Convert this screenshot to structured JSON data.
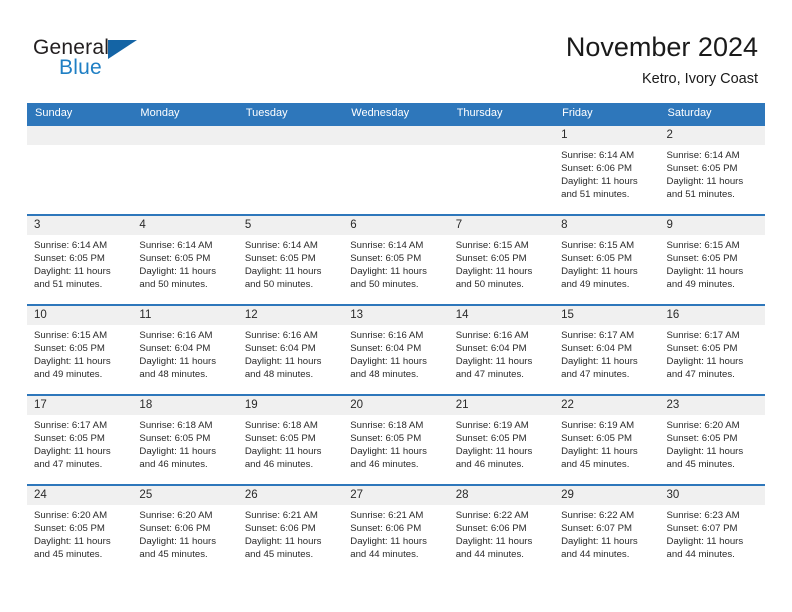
{
  "logo": {
    "word_top": "General",
    "word_bottom": "Blue",
    "triangle_color": "#1464a5",
    "blue_text_color": "#1f7fc4"
  },
  "header": {
    "title": "November 2024",
    "subtitle": "Ketro, Ivory Coast"
  },
  "theme": {
    "header_blue": "#2e77bb",
    "day_head_gray": "#f0f0f0",
    "text": "#2a2a2a"
  },
  "weekdays": [
    "Sunday",
    "Monday",
    "Tuesday",
    "Wednesday",
    "Thursday",
    "Friday",
    "Saturday"
  ],
  "weeks": [
    [
      {
        "day": "",
        "sunrise": "",
        "sunset": "",
        "daylight1": "",
        "daylight2": ""
      },
      {
        "day": "",
        "sunrise": "",
        "sunset": "",
        "daylight1": "",
        "daylight2": ""
      },
      {
        "day": "",
        "sunrise": "",
        "sunset": "",
        "daylight1": "",
        "daylight2": ""
      },
      {
        "day": "",
        "sunrise": "",
        "sunset": "",
        "daylight1": "",
        "daylight2": ""
      },
      {
        "day": "",
        "sunrise": "",
        "sunset": "",
        "daylight1": "",
        "daylight2": ""
      },
      {
        "day": "1",
        "sunrise": "Sunrise: 6:14 AM",
        "sunset": "Sunset: 6:06 PM",
        "daylight1": "Daylight: 11 hours",
        "daylight2": "and 51 minutes."
      },
      {
        "day": "2",
        "sunrise": "Sunrise: 6:14 AM",
        "sunset": "Sunset: 6:05 PM",
        "daylight1": "Daylight: 11 hours",
        "daylight2": "and 51 minutes."
      }
    ],
    [
      {
        "day": "3",
        "sunrise": "Sunrise: 6:14 AM",
        "sunset": "Sunset: 6:05 PM",
        "daylight1": "Daylight: 11 hours",
        "daylight2": "and 51 minutes."
      },
      {
        "day": "4",
        "sunrise": "Sunrise: 6:14 AM",
        "sunset": "Sunset: 6:05 PM",
        "daylight1": "Daylight: 11 hours",
        "daylight2": "and 50 minutes."
      },
      {
        "day": "5",
        "sunrise": "Sunrise: 6:14 AM",
        "sunset": "Sunset: 6:05 PM",
        "daylight1": "Daylight: 11 hours",
        "daylight2": "and 50 minutes."
      },
      {
        "day": "6",
        "sunrise": "Sunrise: 6:14 AM",
        "sunset": "Sunset: 6:05 PM",
        "daylight1": "Daylight: 11 hours",
        "daylight2": "and 50 minutes."
      },
      {
        "day": "7",
        "sunrise": "Sunrise: 6:15 AM",
        "sunset": "Sunset: 6:05 PM",
        "daylight1": "Daylight: 11 hours",
        "daylight2": "and 50 minutes."
      },
      {
        "day": "8",
        "sunrise": "Sunrise: 6:15 AM",
        "sunset": "Sunset: 6:05 PM",
        "daylight1": "Daylight: 11 hours",
        "daylight2": "and 49 minutes."
      },
      {
        "day": "9",
        "sunrise": "Sunrise: 6:15 AM",
        "sunset": "Sunset: 6:05 PM",
        "daylight1": "Daylight: 11 hours",
        "daylight2": "and 49 minutes."
      }
    ],
    [
      {
        "day": "10",
        "sunrise": "Sunrise: 6:15 AM",
        "sunset": "Sunset: 6:05 PM",
        "daylight1": "Daylight: 11 hours",
        "daylight2": "and 49 minutes."
      },
      {
        "day": "11",
        "sunrise": "Sunrise: 6:16 AM",
        "sunset": "Sunset: 6:04 PM",
        "daylight1": "Daylight: 11 hours",
        "daylight2": "and 48 minutes."
      },
      {
        "day": "12",
        "sunrise": "Sunrise: 6:16 AM",
        "sunset": "Sunset: 6:04 PM",
        "daylight1": "Daylight: 11 hours",
        "daylight2": "and 48 minutes."
      },
      {
        "day": "13",
        "sunrise": "Sunrise: 6:16 AM",
        "sunset": "Sunset: 6:04 PM",
        "daylight1": "Daylight: 11 hours",
        "daylight2": "and 48 minutes."
      },
      {
        "day": "14",
        "sunrise": "Sunrise: 6:16 AM",
        "sunset": "Sunset: 6:04 PM",
        "daylight1": "Daylight: 11 hours",
        "daylight2": "and 47 minutes."
      },
      {
        "day": "15",
        "sunrise": "Sunrise: 6:17 AM",
        "sunset": "Sunset: 6:04 PM",
        "daylight1": "Daylight: 11 hours",
        "daylight2": "and 47 minutes."
      },
      {
        "day": "16",
        "sunrise": "Sunrise: 6:17 AM",
        "sunset": "Sunset: 6:05 PM",
        "daylight1": "Daylight: 11 hours",
        "daylight2": "and 47 minutes."
      }
    ],
    [
      {
        "day": "17",
        "sunrise": "Sunrise: 6:17 AM",
        "sunset": "Sunset: 6:05 PM",
        "daylight1": "Daylight: 11 hours",
        "daylight2": "and 47 minutes."
      },
      {
        "day": "18",
        "sunrise": "Sunrise: 6:18 AM",
        "sunset": "Sunset: 6:05 PM",
        "daylight1": "Daylight: 11 hours",
        "daylight2": "and 46 minutes."
      },
      {
        "day": "19",
        "sunrise": "Sunrise: 6:18 AM",
        "sunset": "Sunset: 6:05 PM",
        "daylight1": "Daylight: 11 hours",
        "daylight2": "and 46 minutes."
      },
      {
        "day": "20",
        "sunrise": "Sunrise: 6:18 AM",
        "sunset": "Sunset: 6:05 PM",
        "daylight1": "Daylight: 11 hours",
        "daylight2": "and 46 minutes."
      },
      {
        "day": "21",
        "sunrise": "Sunrise: 6:19 AM",
        "sunset": "Sunset: 6:05 PM",
        "daylight1": "Daylight: 11 hours",
        "daylight2": "and 46 minutes."
      },
      {
        "day": "22",
        "sunrise": "Sunrise: 6:19 AM",
        "sunset": "Sunset: 6:05 PM",
        "daylight1": "Daylight: 11 hours",
        "daylight2": "and 45 minutes."
      },
      {
        "day": "23",
        "sunrise": "Sunrise: 6:20 AM",
        "sunset": "Sunset: 6:05 PM",
        "daylight1": "Daylight: 11 hours",
        "daylight2": "and 45 minutes."
      }
    ],
    [
      {
        "day": "24",
        "sunrise": "Sunrise: 6:20 AM",
        "sunset": "Sunset: 6:05 PM",
        "daylight1": "Daylight: 11 hours",
        "daylight2": "and 45 minutes."
      },
      {
        "day": "25",
        "sunrise": "Sunrise: 6:20 AM",
        "sunset": "Sunset: 6:06 PM",
        "daylight1": "Daylight: 11 hours",
        "daylight2": "and 45 minutes."
      },
      {
        "day": "26",
        "sunrise": "Sunrise: 6:21 AM",
        "sunset": "Sunset: 6:06 PM",
        "daylight1": "Daylight: 11 hours",
        "daylight2": "and 45 minutes."
      },
      {
        "day": "27",
        "sunrise": "Sunrise: 6:21 AM",
        "sunset": "Sunset: 6:06 PM",
        "daylight1": "Daylight: 11 hours",
        "daylight2": "and 44 minutes."
      },
      {
        "day": "28",
        "sunrise": "Sunrise: 6:22 AM",
        "sunset": "Sunset: 6:06 PM",
        "daylight1": "Daylight: 11 hours",
        "daylight2": "and 44 minutes."
      },
      {
        "day": "29",
        "sunrise": "Sunrise: 6:22 AM",
        "sunset": "Sunset: 6:07 PM",
        "daylight1": "Daylight: 11 hours",
        "daylight2": "and 44 minutes."
      },
      {
        "day": "30",
        "sunrise": "Sunrise: 6:23 AM",
        "sunset": "Sunset: 6:07 PM",
        "daylight1": "Daylight: 11 hours",
        "daylight2": "and 44 minutes."
      }
    ]
  ]
}
